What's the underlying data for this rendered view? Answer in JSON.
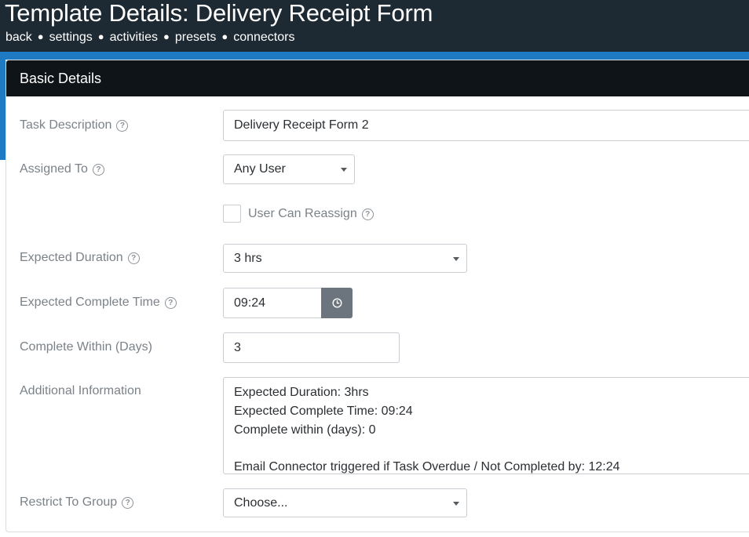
{
  "header": {
    "title": "Template Details: Delivery Receipt Form",
    "nav": [
      "back",
      "settings",
      "activities",
      "presets",
      "connectors"
    ],
    "separator": "●"
  },
  "panel": {
    "title": "Basic Details"
  },
  "form": {
    "task_description": {
      "label": "Task Description",
      "value": "Delivery Receipt Form 2"
    },
    "assigned_to": {
      "label": "Assigned To",
      "value": "Any User"
    },
    "user_can_reassign": {
      "label": "User Can Reassign",
      "checked": false
    },
    "expected_duration": {
      "label": "Expected Duration",
      "value": "3 hrs"
    },
    "expected_complete_time": {
      "label": "Expected Complete Time",
      "value": "09:24",
      "icon": "clock-icon"
    },
    "complete_within_days": {
      "label": "Complete Within (Days)",
      "value": "3"
    },
    "additional_information": {
      "label": "Additional Information",
      "lines": [
        "Expected Duration: 3hrs",
        "Expected Complete Time: 09:24",
        "Complete within (days): 0",
        "",
        "Email Connector triggered if Task Overdue / Not Completed by: 12:24"
      ]
    },
    "restrict_to_group": {
      "label": "Restrict To Group",
      "value": "Choose..."
    },
    "help_glyph": "?"
  },
  "colors": {
    "topbar": "#1e2a33",
    "accent": "#1f7ac4",
    "panel_header": "#0f1418",
    "label_text": "#7b8288",
    "button_gray": "#6c757d"
  }
}
